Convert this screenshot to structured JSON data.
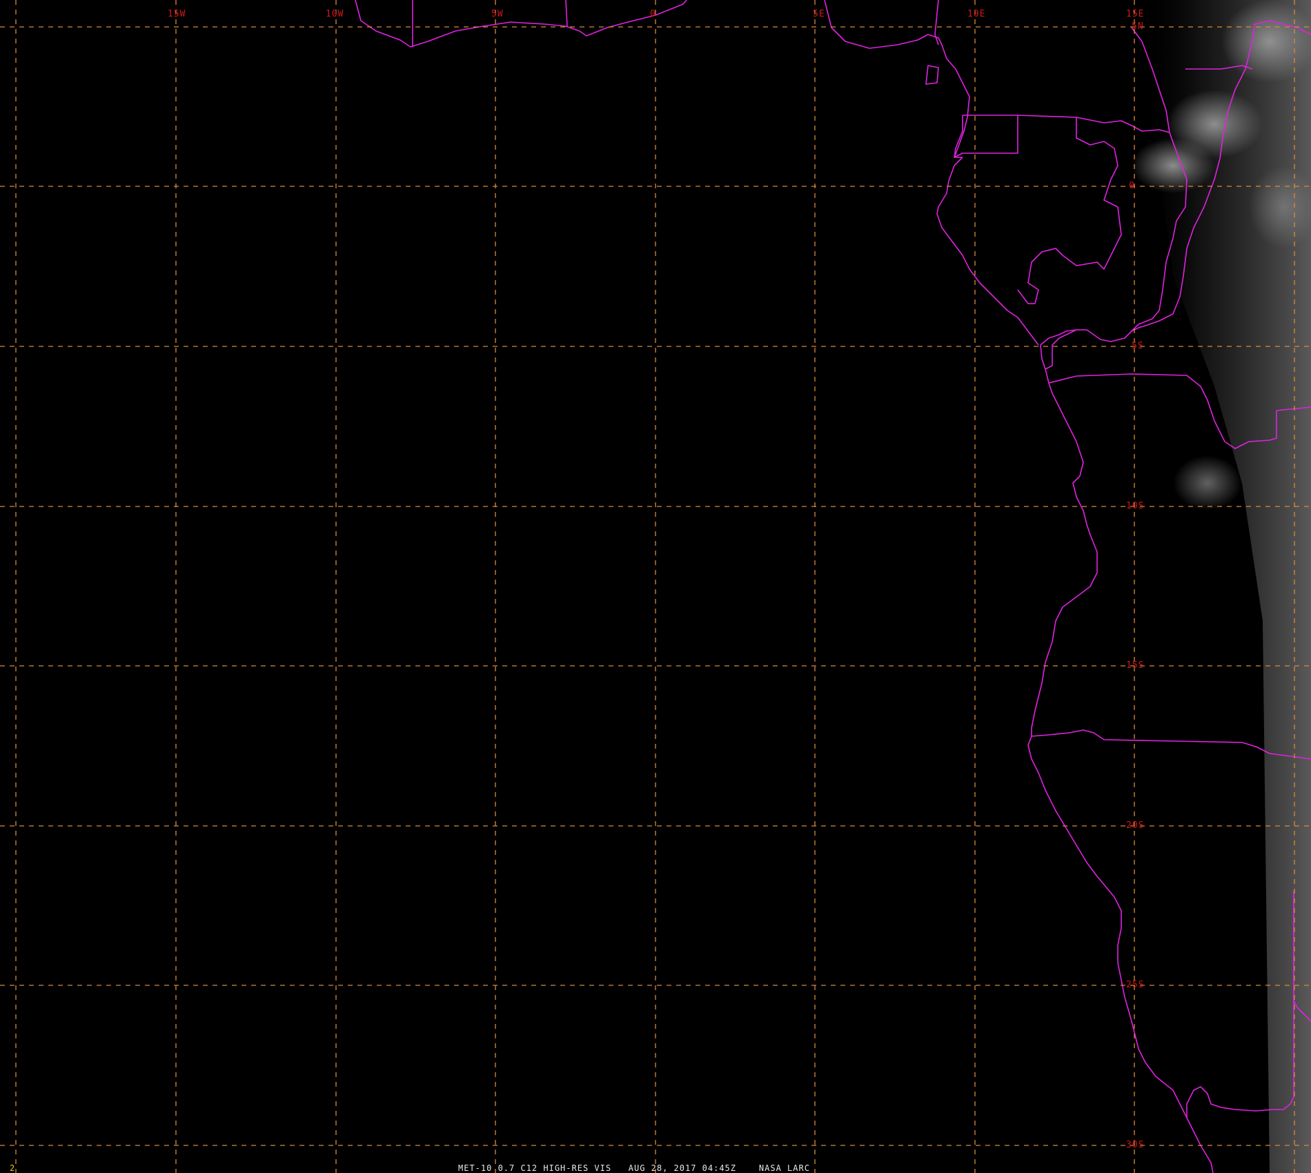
{
  "map": {
    "longitude_labels": [
      "15W",
      "10W",
      "5W",
      "0",
      "5E",
      "10E",
      "15E"
    ],
    "latitude_labels": [
      "5N",
      "0",
      "5S",
      "10S",
      "15S",
      "20S",
      "25S",
      "30S"
    ],
    "frame_number": "2",
    "caption": "MET-10 0.7 C12 HIGH-RES VIS   AUG 28, 2017 04:45Z    NASA LARC",
    "colors": {
      "background": "#000000",
      "gridlines": "#d98a3a",
      "grid_labels": "#d01818",
      "borders": "#e022e0",
      "caption": "#e8e8e8",
      "frame_number": "#e8d000"
    }
  }
}
